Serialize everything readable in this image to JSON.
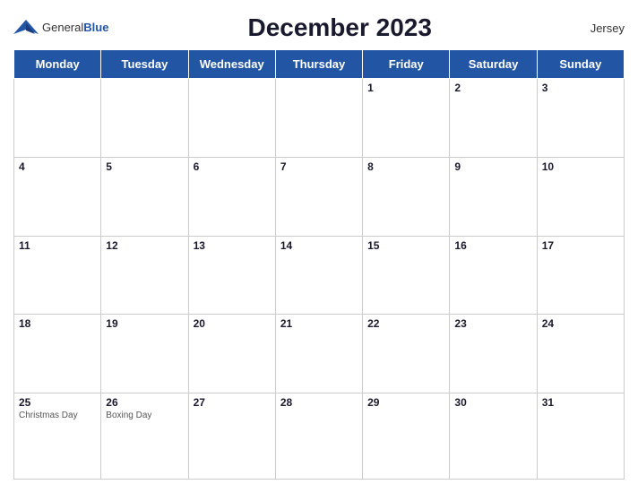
{
  "header": {
    "logo_general": "General",
    "logo_blue": "Blue",
    "title": "December 2023",
    "region": "Jersey"
  },
  "weekdays": [
    "Monday",
    "Tuesday",
    "Wednesday",
    "Thursday",
    "Friday",
    "Saturday",
    "Sunday"
  ],
  "weeks": [
    [
      {
        "day": "",
        "events": []
      },
      {
        "day": "",
        "events": []
      },
      {
        "day": "",
        "events": []
      },
      {
        "day": "",
        "events": []
      },
      {
        "day": "1",
        "events": []
      },
      {
        "day": "2",
        "events": []
      },
      {
        "day": "3",
        "events": []
      }
    ],
    [
      {
        "day": "4",
        "events": []
      },
      {
        "day": "5",
        "events": []
      },
      {
        "day": "6",
        "events": []
      },
      {
        "day": "7",
        "events": []
      },
      {
        "day": "8",
        "events": []
      },
      {
        "day": "9",
        "events": []
      },
      {
        "day": "10",
        "events": []
      }
    ],
    [
      {
        "day": "11",
        "events": []
      },
      {
        "day": "12",
        "events": []
      },
      {
        "day": "13",
        "events": []
      },
      {
        "day": "14",
        "events": []
      },
      {
        "day": "15",
        "events": []
      },
      {
        "day": "16",
        "events": []
      },
      {
        "day": "17",
        "events": []
      }
    ],
    [
      {
        "day": "18",
        "events": []
      },
      {
        "day": "19",
        "events": []
      },
      {
        "day": "20",
        "events": []
      },
      {
        "day": "21",
        "events": []
      },
      {
        "day": "22",
        "events": []
      },
      {
        "day": "23",
        "events": []
      },
      {
        "day": "24",
        "events": []
      }
    ],
    [
      {
        "day": "25",
        "events": [
          "Christmas Day"
        ]
      },
      {
        "day": "26",
        "events": [
          "Boxing Day"
        ]
      },
      {
        "day": "27",
        "events": []
      },
      {
        "day": "28",
        "events": []
      },
      {
        "day": "29",
        "events": []
      },
      {
        "day": "30",
        "events": []
      },
      {
        "day": "31",
        "events": []
      }
    ]
  ]
}
